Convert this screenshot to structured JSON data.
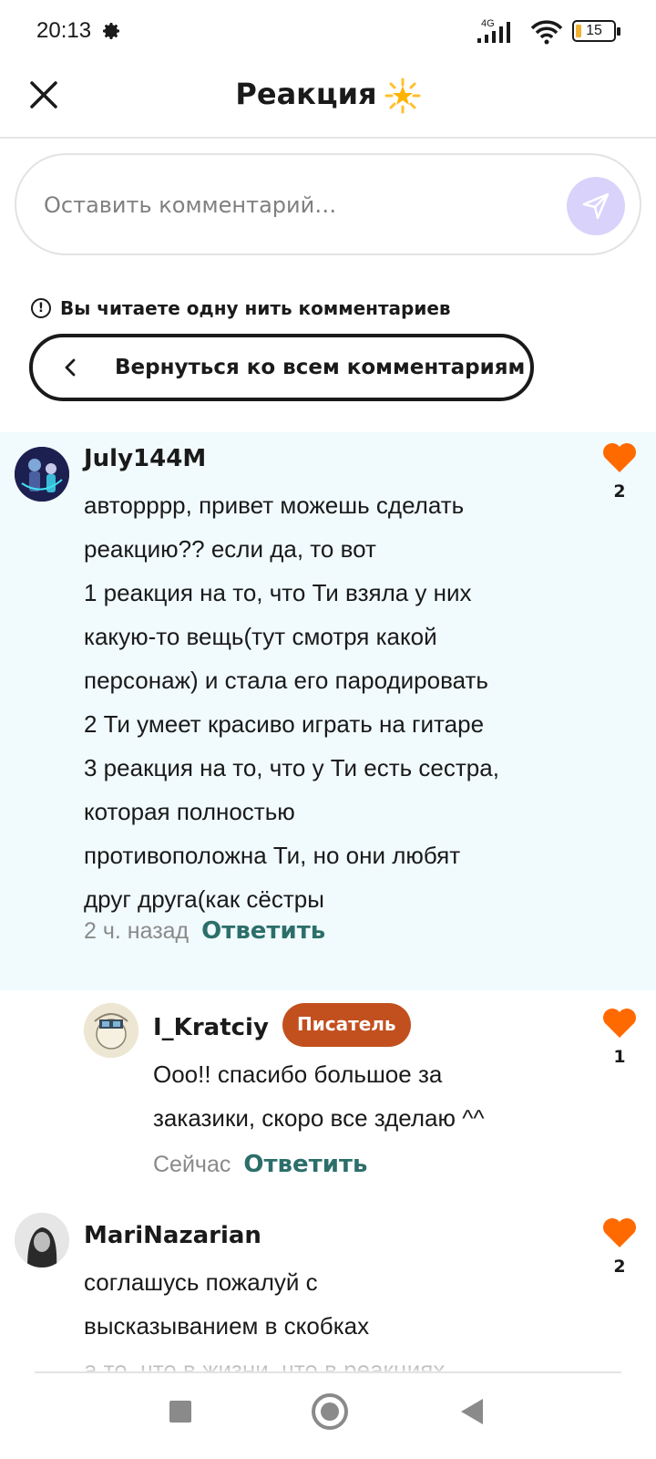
{
  "status_bar": {
    "time": "20:13",
    "network": "4G",
    "battery": "15",
    "icons": [
      "gear-icon",
      "signal-icon",
      "wifi-icon",
      "battery-icon"
    ]
  },
  "header": {
    "title": "Реакция",
    "emoji": "star-emoji",
    "close_icon": "close-icon"
  },
  "comment_input": {
    "placeholder": "Оставить комментарий…",
    "send_icon": "send-icon",
    "send_color": "#d9d2fb"
  },
  "thread": {
    "notice": "Вы читаете одну нить комментариев",
    "back_label": "Вернуться ко всем комментариям"
  },
  "comments": [
    {
      "username": "July144M",
      "text": "авторррр, привет можешь сделать\nреакцию?? если да, то вот\n1 реакция на то, что Ти  взяла у них\nкакую-то вещь(тут смотря какой\nперсонаж) и стала его пародировать\n2 Ти умеет красиво играть на гитаре\n3 реакция на то, что у Ти есть сестра,\nкоторая полностью\nпротивоположна Ти, но они любят\nдруг друга(как сёстры",
      "time": "2 ч. назад",
      "reply_label": "Ответить",
      "likes": "2"
    },
    {
      "username": "I_Kratciy",
      "badge": "Писатель",
      "text": "Ооо!! спасибо большое за\nзаказики, скоро все зделаю ^^",
      "time": "Сейчас",
      "reply_label": "Ответить",
      "likes": "1"
    },
    {
      "username": "MariNazarian",
      "text": "соглашусь пожалуй с\nвысказыванием в скобках\nа то, что в жизни, что в реакциях",
      "likes": "2"
    }
  ],
  "colors": {
    "accent_like": "#ff6a00",
    "reply_link": "#2c6e6a",
    "writer_badge": "#c2501f",
    "thread_bg": "#f1fafd"
  }
}
